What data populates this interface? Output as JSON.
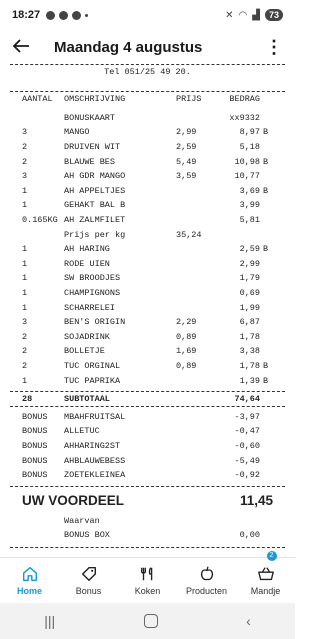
{
  "status": {
    "time": "18:27",
    "battery": "73"
  },
  "header": {
    "title": "Maandag 4 augustus"
  },
  "receipt": {
    "phone": "Tel 051/25 49 20.",
    "columns": {
      "qty": "AANTAL",
      "desc": "OMSCHRIJVING",
      "price": "PRIJS",
      "amount": "BEDRAG"
    },
    "items": [
      {
        "qty": "",
        "desc": "BONUSKAART",
        "price": "",
        "amount": "xx9332",
        "flag": ""
      },
      {
        "qty": "3",
        "desc": "MANGO",
        "price": "2,99",
        "amount": "8,97",
        "flag": "B"
      },
      {
        "qty": "2",
        "desc": "DRUIVEN WIT",
        "price": "2,59",
        "amount": "5,18",
        "flag": ""
      },
      {
        "qty": "2",
        "desc": "BLAUWE BES",
        "price": "5,49",
        "amount": "10,98",
        "flag": "B"
      },
      {
        "qty": "3",
        "desc": "AH GDR MANGO",
        "price": "3,59",
        "amount": "10,77",
        "flag": ""
      },
      {
        "qty": "1",
        "desc": "AH APPELTJES",
        "price": "",
        "amount": "3,69",
        "flag": "B"
      },
      {
        "qty": "1",
        "desc": "GEHAKT BAL B",
        "price": "",
        "amount": "3,99",
        "flag": ""
      },
      {
        "qty": "0.165KG",
        "desc": "AH ZALMFILET",
        "price": "",
        "amount": "5,81",
        "flag": ""
      },
      {
        "qty": "",
        "desc": "Prijs per kg",
        "price": "35,24",
        "amount": "",
        "flag": ""
      },
      {
        "qty": "1",
        "desc": "AH HARING",
        "price": "",
        "amount": "2,59",
        "flag": "B"
      },
      {
        "qty": "1",
        "desc": "RODE UIEN",
        "price": "",
        "amount": "2,99",
        "flag": ""
      },
      {
        "qty": "1",
        "desc": "SW BROODJES",
        "price": "",
        "amount": "1,79",
        "flag": ""
      },
      {
        "qty": "1",
        "desc": "CHAMPIGNONS",
        "price": "",
        "amount": "0,69",
        "flag": ""
      },
      {
        "qty": "1",
        "desc": "SCHARRELEI",
        "price": "",
        "amount": "1,99",
        "flag": ""
      },
      {
        "qty": "3",
        "desc": "BEN'S ORIGIN",
        "price": "2,29",
        "amount": "6,87",
        "flag": ""
      },
      {
        "qty": "2",
        "desc": "SOJADRINK",
        "price": "0,89",
        "amount": "1,78",
        "flag": ""
      },
      {
        "qty": "2",
        "desc": "BOLLETJE",
        "price": "1,69",
        "amount": "3,38",
        "flag": ""
      },
      {
        "qty": "2",
        "desc": "TUC ORGINAL",
        "price": "0,89",
        "amount": "1,78",
        "flag": "B"
      },
      {
        "qty": "1",
        "desc": "TUC PAPRIKA",
        "price": "",
        "amount": "1,39",
        "flag": "B"
      }
    ],
    "subtotal": {
      "qty": "28",
      "label": "SUBTOTAAL",
      "amount": "74,64"
    },
    "bonuses": [
      {
        "label": "BONUS",
        "desc": "MBAHFRUITSAL",
        "amount": "-3,97"
      },
      {
        "label": "BONUS",
        "desc": "ALLETUC",
        "amount": "-0,47"
      },
      {
        "label": "BONUS",
        "desc": "AHHARING2ST",
        "amount": "-0,60"
      },
      {
        "label": "BONUS",
        "desc": "AHBLAUWEBESS",
        "amount": "-5,49"
      },
      {
        "label": "BONUS",
        "desc": "ZOETEKLEINEA",
        "amount": "-0,92"
      }
    ],
    "voordeel": {
      "label": "UW VOORDEEL",
      "amount": "11,45"
    },
    "waarvan": {
      "label": "Waarvan"
    },
    "bonusbox": {
      "label": "BONUS BOX",
      "amount": "0,00"
    }
  },
  "nav": {
    "items": [
      {
        "label": "Home"
      },
      {
        "label": "Bonus"
      },
      {
        "label": "Koken"
      },
      {
        "label": "Producten"
      },
      {
        "label": "Mandje",
        "badge": "2"
      }
    ]
  },
  "colors": {
    "accent": "#179ad8"
  }
}
